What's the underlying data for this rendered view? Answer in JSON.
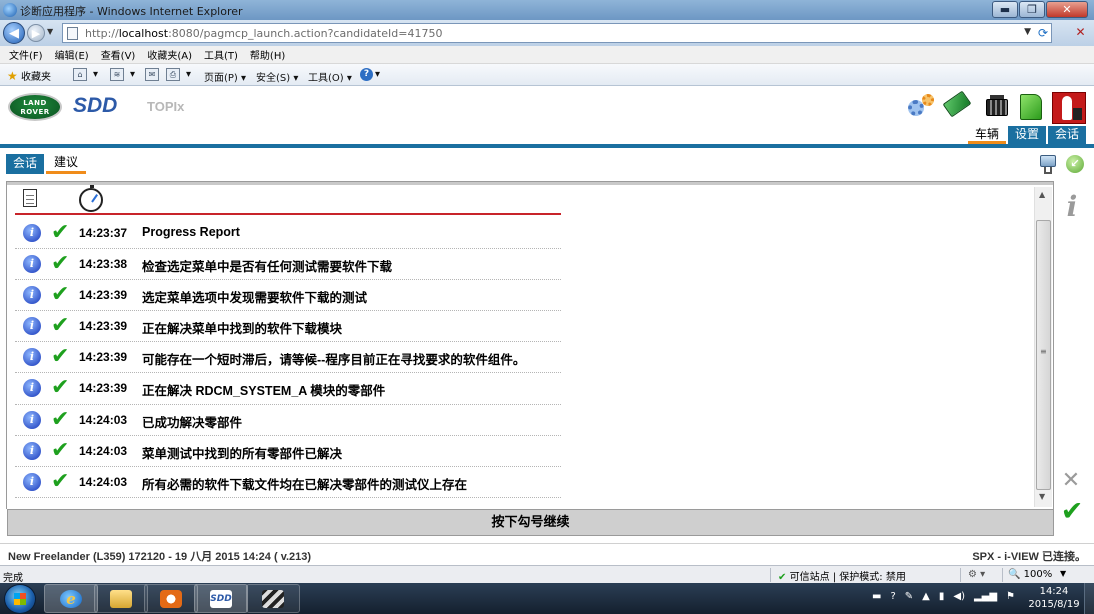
{
  "window": {
    "title": "诊断应用程序 - Windows Internet Explorer",
    "minimize_label": "▬",
    "maximize_label": "❐",
    "close_label": "✕"
  },
  "address": {
    "url_prefix": "http://",
    "url_host": "localhost",
    "url_rest": ":8080/pagmcp_launch.action?candidateId=41750"
  },
  "menu": [
    "文件(F)",
    "编辑(E)",
    "查看(V)",
    "收藏夹(A)",
    "工具(T)",
    "帮助(H)"
  ],
  "favbar": {
    "favorites": "收藏夹",
    "page": "页面(P)",
    "safety": "安全(S)",
    "tools": "工具(O)"
  },
  "app": {
    "brand_badge": "LAND ROVER",
    "sdd_logo": "SDD",
    "topix": "TOPIx",
    "top_tabs": [
      "车辆",
      "设置",
      "会话"
    ],
    "sub_tabs": [
      "会话",
      "建议"
    ]
  },
  "log": {
    "rows": [
      {
        "time": "14:23:37",
        "message": "Progress Report"
      },
      {
        "time": "14:23:38",
        "message": "检查选定菜单中是否有任何测试需要软件下载"
      },
      {
        "time": "14:23:39",
        "message": "选定菜单选项中发现需要软件下载的测试"
      },
      {
        "time": "14:23:39",
        "message": "正在解决菜单中找到的软件下载模块"
      },
      {
        "time": "14:23:39",
        "message": "可能存在一个短时滞后，请等候--程序目前正在寻找要求的软件组件。"
      },
      {
        "time": "14:23:39",
        "message": "正在解决  RDCM_SYSTEM_A 模块的零部件"
      },
      {
        "time": "14:24:03",
        "message": "已成功解决零部件"
      },
      {
        "time": "14:24:03",
        "message": "菜单测试中找到的所有零部件已解决"
      },
      {
        "time": "14:24:03",
        "message": "所有必需的软件下载文件均在已解决零部件的测试仪上存在"
      }
    ]
  },
  "continue_label": "按下勾号继续",
  "status": {
    "vehicle": "New Freelander (L359) 172120 - 19 八月 2015 14:24 ( v.213)",
    "connection": "SPX - i-VIEW 已连接。"
  },
  "ie_status": {
    "done": "完成",
    "trust": "可信站点 | 保护模式: 禁用",
    "zoom": "100%"
  },
  "taskbar": {
    "sdd_label": "SDD",
    "time": "14:24",
    "date": "2015/8/19"
  }
}
